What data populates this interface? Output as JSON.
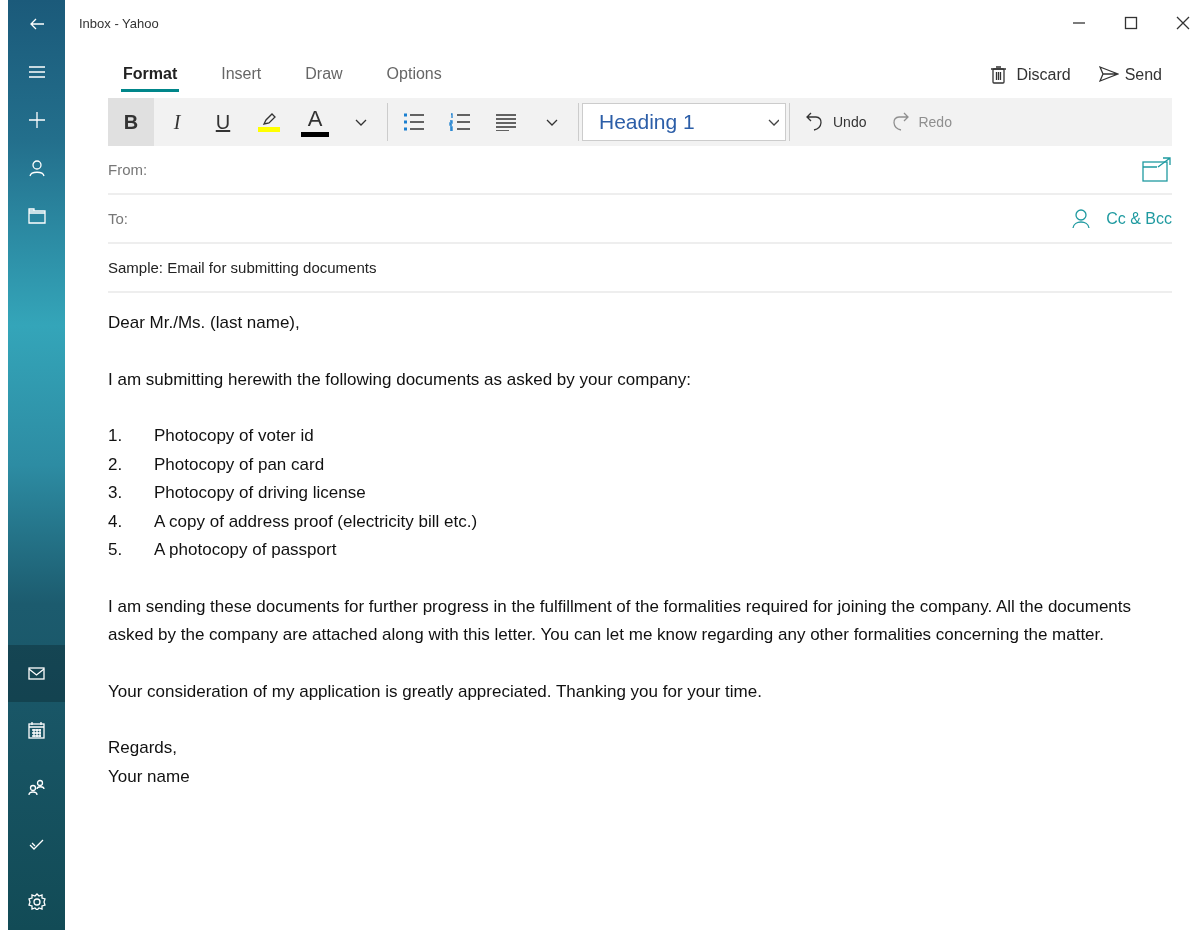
{
  "window": {
    "title": "Inbox - Yahoo"
  },
  "nav": {
    "top": [
      {
        "kind": "back"
      },
      {
        "kind": "menu"
      },
      {
        "kind": "add"
      },
      {
        "kind": "account"
      },
      {
        "kind": "folder"
      }
    ],
    "bottom": [
      {
        "kind": "mail",
        "selected": true
      },
      {
        "kind": "calendar",
        "selected": false
      },
      {
        "kind": "people",
        "selected": false
      },
      {
        "kind": "todo",
        "selected": false
      },
      {
        "kind": "settings",
        "selected": false
      }
    ]
  },
  "tabs": [
    {
      "label": "Format",
      "selected": true
    },
    {
      "label": "Insert",
      "selected": false
    },
    {
      "label": "Draw",
      "selected": false
    },
    {
      "label": "Options",
      "selected": false
    }
  ],
  "actions": [
    {
      "kind": "discard",
      "label": "Discard"
    },
    {
      "kind": "send",
      "label": "Send"
    }
  ],
  "toolbar": {
    "tools": [
      {
        "kind": "bold",
        "label": "B",
        "selected": true
      },
      {
        "kind": "italic",
        "label": "I",
        "selected": false
      },
      {
        "kind": "underline",
        "label": "U",
        "selected": false
      },
      {
        "kind": "highlight",
        "color": "#ffff00"
      },
      {
        "kind": "fontcolor",
        "label": "A",
        "color": "#000000"
      },
      {
        "kind": "caret"
      },
      {
        "kind": "sep"
      },
      {
        "kind": "bullets"
      },
      {
        "kind": "numbering"
      },
      {
        "kind": "align"
      },
      {
        "kind": "caret"
      },
      {
        "kind": "sep"
      }
    ],
    "style": "Heading 1",
    "history": [
      {
        "kind": "undo",
        "label": "Undo",
        "disabled": false
      },
      {
        "kind": "redo",
        "label": "Redo",
        "disabled": true
      }
    ]
  },
  "from": {
    "label": "From:"
  },
  "to": {
    "label": "To:",
    "cc": "Cc & Bcc"
  },
  "subject": "Sample: Email for submitting documents",
  "body": [
    {
      "kind": "para",
      "text": "Dear Mr./Ms. (last name),"
    },
    {
      "kind": "para",
      "text": "I am submitting herewith the following documents as asked by your company:"
    },
    {
      "kind": "list",
      "items": [
        {
          "num": "1.",
          "text": "Photocopy of voter id"
        },
        {
          "num": "2.",
          "text": "Photocopy of pan card"
        },
        {
          "num": "3.",
          "text": "Photocopy of driving license"
        },
        {
          "num": "4.",
          "text": "A copy of address proof (electricity bill etc.)"
        },
        {
          "num": "5.",
          "text": "A photocopy of passport"
        }
      ]
    },
    {
      "kind": "para",
      "text": "I am sending these documents for further progress in the fulfillment of the formalities required for joining the company. All the documents asked by the company are attached along with this letter. You can let me know regarding any other formalities concerning the matter."
    },
    {
      "kind": "para",
      "text": "Your consideration of my application is greatly appreciated. Thanking you for your time."
    },
    {
      "kind": "lines",
      "lines": [
        "Regards,",
        "Your name"
      ]
    }
  ]
}
